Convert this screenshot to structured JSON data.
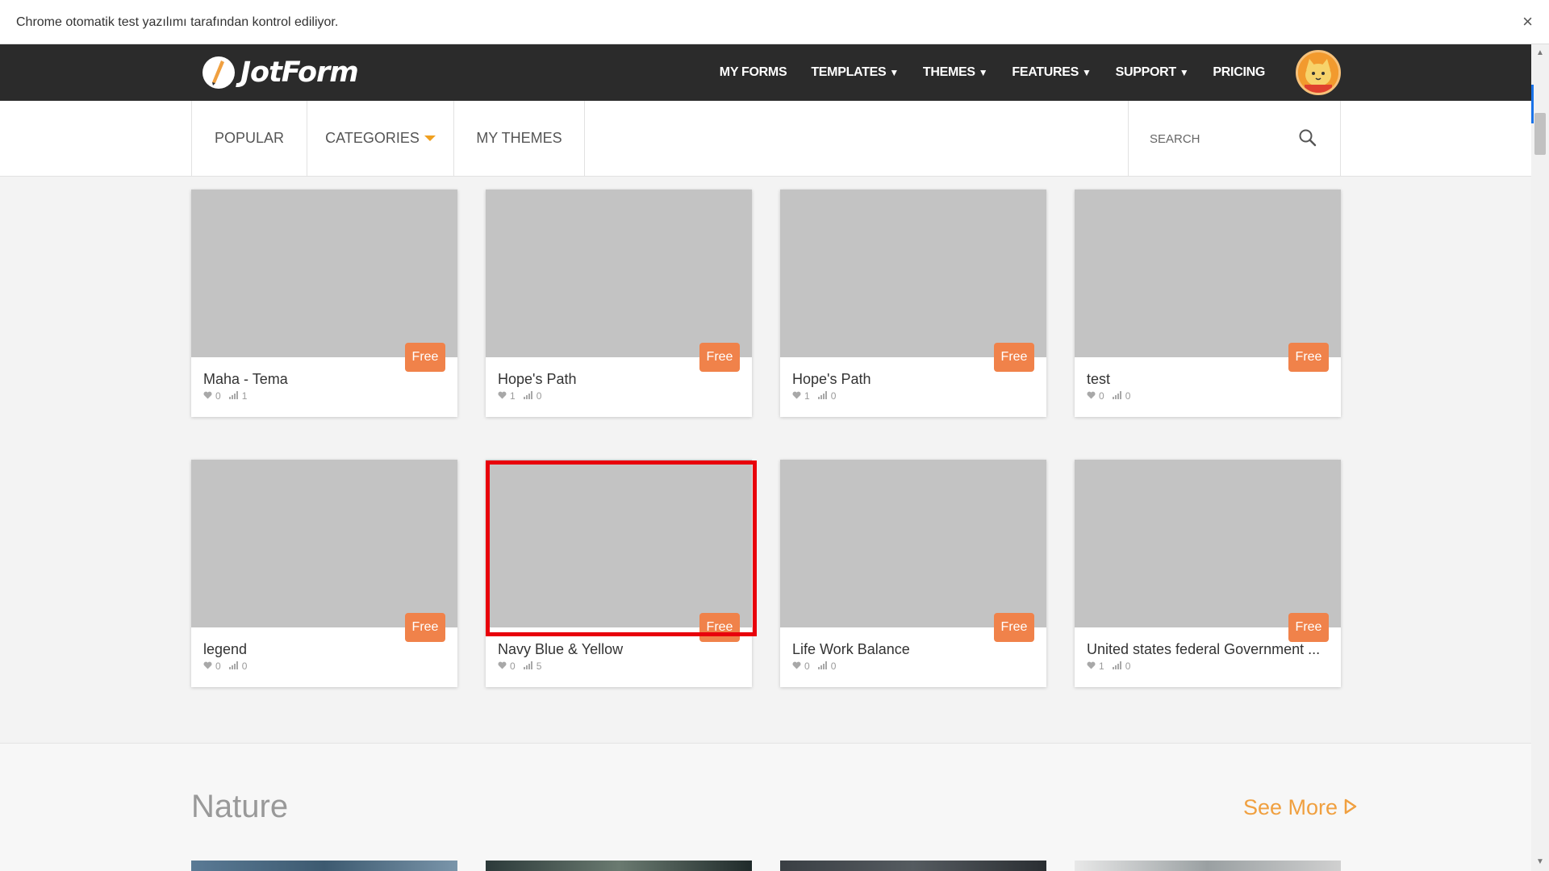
{
  "infobar": {
    "message": "Chrome otomatik test yazılımı tarafından kontrol ediliyor.",
    "close_label": "×"
  },
  "topnav": {
    "logo_text": "JotForm",
    "links": [
      {
        "label": "MY FORMS",
        "caret": ""
      },
      {
        "label": "TEMPLATES",
        "caret": "▼"
      },
      {
        "label": "THEMES",
        "caret": "▼"
      },
      {
        "label": "FEATURES",
        "caret": "▼"
      },
      {
        "label": "SUPPORT",
        "caret": "▼"
      },
      {
        "label": "PRICING",
        "caret": ""
      }
    ]
  },
  "subnav": {
    "tabs": [
      "POPULAR",
      "CATEGORIES",
      "MY THEMES"
    ],
    "search_placeholder": "SEARCH"
  },
  "cards": [
    {
      "title": "Maha - Tema",
      "badge": "Free",
      "likes": "0",
      "uses": "1"
    },
    {
      "title": "Hope's Path",
      "badge": "Free",
      "likes": "1",
      "uses": "0"
    },
    {
      "title": "Hope's Path",
      "badge": "Free",
      "likes": "1",
      "uses": "0"
    },
    {
      "title": "test",
      "badge": "Free",
      "likes": "0",
      "uses": "0"
    },
    {
      "title": "legend",
      "badge": "Free",
      "likes": "0",
      "uses": "0"
    },
    {
      "title": "Navy Blue & Yellow",
      "badge": "Free",
      "likes": "0",
      "uses": "5"
    },
    {
      "title": "Life Work Balance",
      "badge": "Free",
      "likes": "0",
      "uses": "0"
    },
    {
      "title": "United states federal Government ...",
      "badge": "Free",
      "likes": "1",
      "uses": "0"
    }
  ],
  "section": {
    "title": "Nature",
    "see_more": "See More"
  },
  "colors": {
    "topnav_bg": "#2b2b2b",
    "badge_bg": "#f0824a",
    "accent": "#f0a040",
    "highlight": "#e8000b"
  }
}
